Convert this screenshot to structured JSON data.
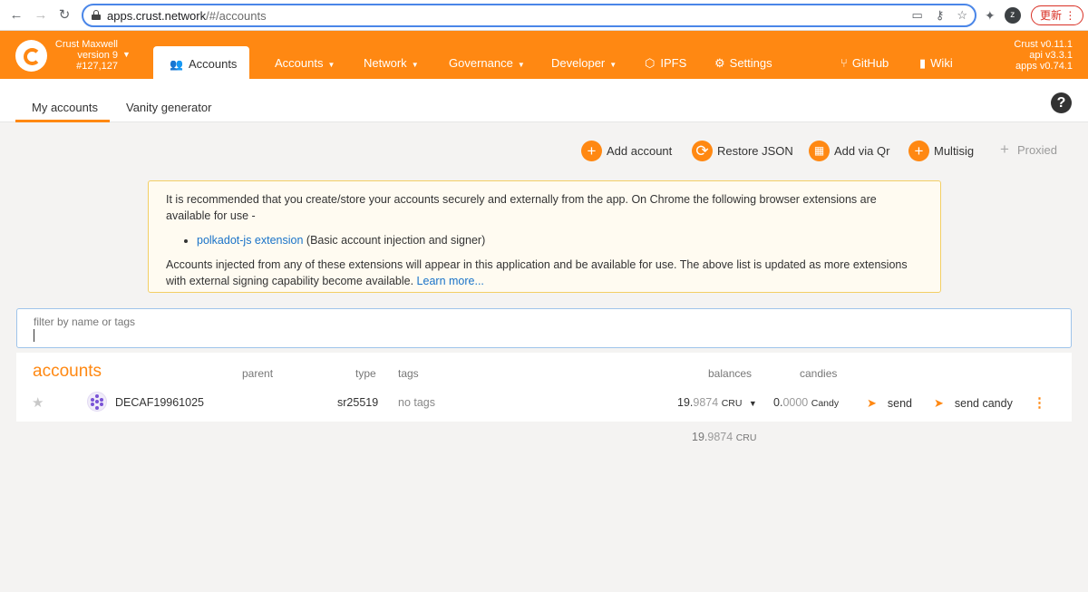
{
  "browser": {
    "url_host": "apps.crust.network",
    "url_path": "/#/accounts",
    "update_label": "更新"
  },
  "header": {
    "chain_name": "Crust Maxwell",
    "chain_version": "version 9",
    "block_number": "#127,127",
    "active_tab": "Accounts",
    "menu": [
      {
        "label": "Accounts",
        "dropdown": true
      },
      {
        "label": "Network",
        "dropdown": true
      },
      {
        "label": "Governance",
        "dropdown": true
      },
      {
        "label": "Developer",
        "dropdown": true
      },
      {
        "label": "IPFS",
        "dropdown": false
      },
      {
        "label": "Settings",
        "dropdown": false
      },
      {
        "label": "GitHub",
        "dropdown": false
      },
      {
        "label": "Wiki",
        "dropdown": false
      }
    ],
    "versions": [
      "Crust v0.11.1",
      "api v3.3.1",
      "apps v0.74.1"
    ]
  },
  "subtabs": [
    "My accounts",
    "Vanity generator"
  ],
  "actions": [
    "Add account",
    "Restore JSON",
    "Add via Qr",
    "Multisig",
    "Proxied"
  ],
  "info": {
    "para1": "It is recommended that you create/store your accounts securely and externally from the app. On Chrome the following browser extensions are available for use -",
    "ext_link": "polkadot-js extension",
    "ext_desc": " (Basic account injection and signer)",
    "para2": "Accounts injected from any of these extensions will appear in this application and be available for use. The above list is updated as more extensions with external signing capability become available. ",
    "learn_more": "Learn more..."
  },
  "filter": {
    "label": "filter by name or tags",
    "value": ""
  },
  "table": {
    "title": "accounts",
    "headers": {
      "parent": "parent",
      "type": "type",
      "tags": "tags",
      "balances": "balances",
      "candies": "candies"
    },
    "row": {
      "name": "DECAF19961025",
      "type": "sr25519",
      "tags": "no tags",
      "balance_int": "19.",
      "balance_dec": "9874",
      "balance_unit": "CRU",
      "candy_int": "0.",
      "candy_dec": "0000",
      "candy_unit": "Candy",
      "send": "send",
      "send_candy": "send candy"
    }
  },
  "total": {
    "int": "19.",
    "dec": "9874",
    "unit": "CRU"
  }
}
